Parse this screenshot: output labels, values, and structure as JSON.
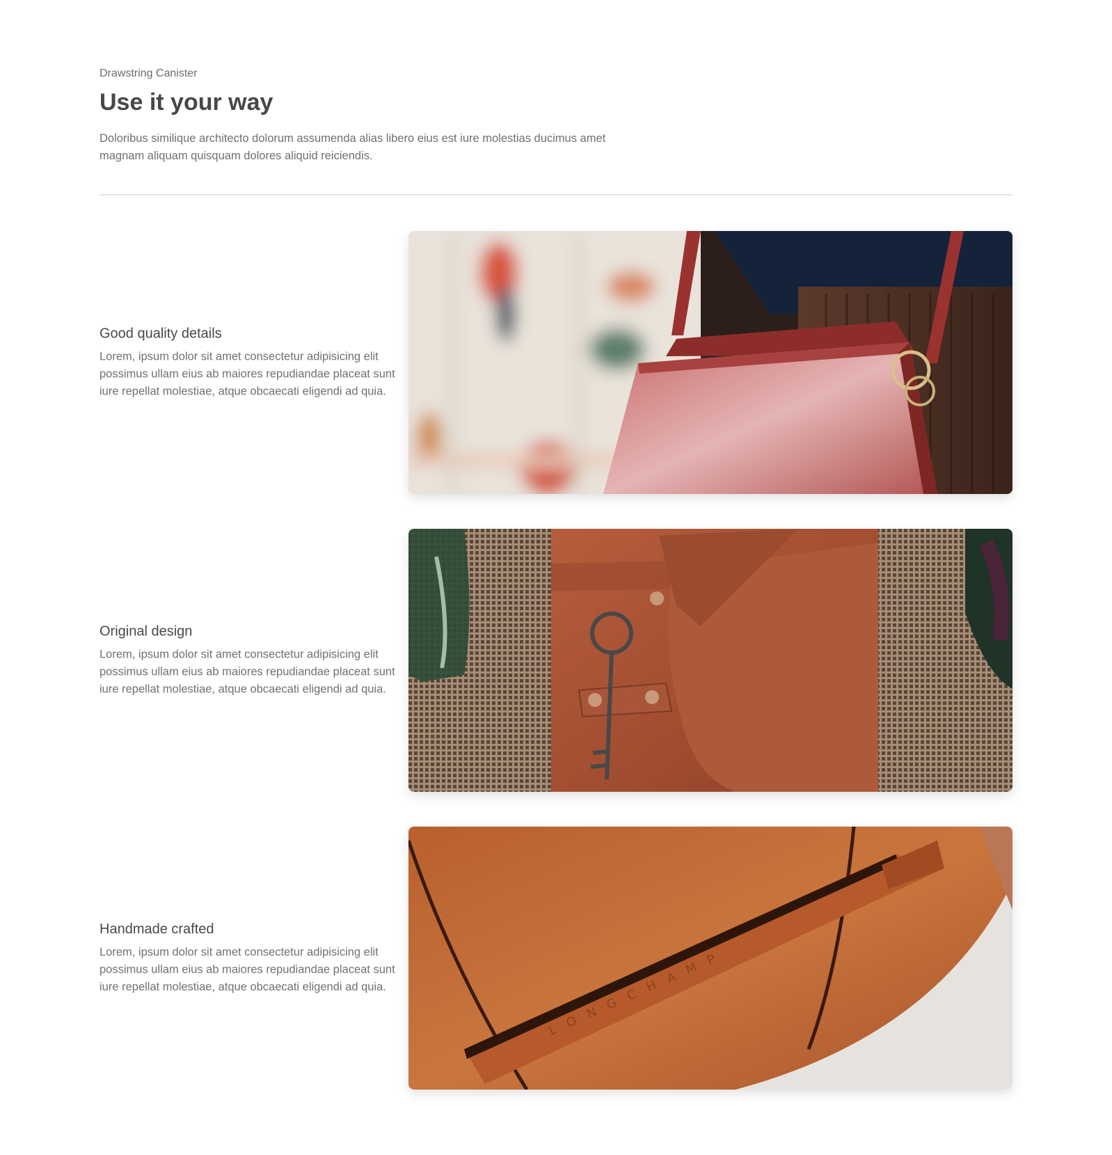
{
  "header": {
    "eyebrow": "Drawstring Canister",
    "title": "Use it your way",
    "intro": "Doloribus similique architecto dolorum assumenda alias libero eius est iure molestias ducimus amet magnam aliquam quisquam dolores aliquid reiciendis."
  },
  "features": [
    {
      "title": "Good quality details",
      "body": "Lorem, ipsum dolor sit amet consectetur adipisicing elit possimus ullam eius ab maiores repudiandae placeat sunt iure repellat molestiae, atque obcaecati eligendi ad quia.",
      "image": "red-leather-bag-photo"
    },
    {
      "title": "Original design",
      "body": "Lorem, ipsum dolor sit amet consectetur adipisicing elit possimus ullam eius ab maiores repudiandae placeat sunt iure repellat molestiae, atque obcaecati eligendi ad quia.",
      "image": "leather-journal-with-key-photo"
    },
    {
      "title": "Handmade crafted",
      "body": "Lorem, ipsum dolor sit amet consectetur adipisicing elit possimus ullam eius ab maiores repudiandae placeat sunt iure repellat molestiae, atque obcaecati eligendi ad quia.",
      "image": "tan-leather-bag-strap-photo",
      "embossed_text": "LONGCHAMP"
    }
  ],
  "colors": {
    "heading": "#474747",
    "body": "#707070",
    "divider": "#e3e3e3"
  }
}
